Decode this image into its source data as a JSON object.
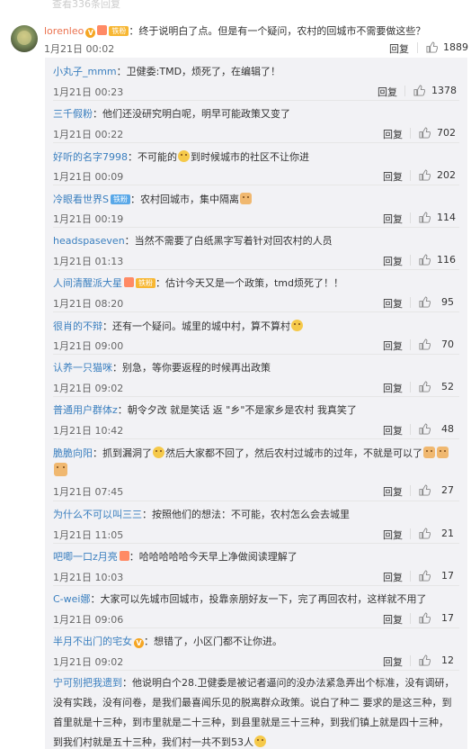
{
  "more_link": "查看336条回复",
  "main": {
    "username": "lorenleo",
    "text": "：终于说明白了点。但是有一个疑问，农村的回城市不需要做这些？",
    "time": "1月21日 00:02",
    "reply_label": "回复",
    "likes": "1889"
  },
  "replies": [
    {
      "user": "小丸子_mmm",
      "text": "：卫健委:TMD，烦死了，在编辑了！",
      "time": "1月21日 00:23",
      "likes": "1378"
    },
    {
      "user": "三千假粉",
      "text": "：他们还没研究明白呢，明早可能政策又变了",
      "time": "1月21日 00:22",
      "likes": "702"
    },
    {
      "user": "好听的名字7998",
      "text_a": "：不可能的",
      "text_b": "到时候城市的社区不让你进",
      "time": "1月21日 00:09",
      "likes": "202"
    },
    {
      "user": "冷眼看世界S",
      "badge": "铁粉",
      "text_a": "：农村回城市，集中隔离",
      "time": "1月21日 00:19",
      "likes": "114"
    },
    {
      "user": "headspaseven",
      "text": "：当然不需要了白纸黑字写着针对回农村的人员",
      "time": "1月21日 01:13",
      "likes": "116"
    },
    {
      "user": "人间清醒派大星",
      "badge": "铁粉",
      "text": "：估计今天又是一个政策，tmd烦死了！！",
      "time": "1月21日 08:20",
      "likes": "95"
    },
    {
      "user": "很肖的不辩",
      "text_a": "：还有一个疑问。城里的城中村，算不算村",
      "time": "1月21日 09:00",
      "likes": "70"
    },
    {
      "user": "认养一只猫咪",
      "text": "：别急，等你要返程的时候再出政策",
      "time": "1月21日 09:02",
      "likes": "52"
    },
    {
      "user": "普通用户群体z",
      "text": "：朝令夕改 就是笑话 返 \"乡\"不是家乡是农村 我真笑了",
      "time": "1月21日 10:42",
      "likes": "48"
    },
    {
      "user": "脆脆向阳",
      "text_a": "：抓到漏洞了",
      "text_b": "然后大家都不回了，然后农村过城市的过年，不就是可以了",
      "time": "1月21日 07:45",
      "likes": "27"
    },
    {
      "user": "为什么不可以叫三三",
      "text": "：按照他们的想法：不可能，农村怎么会去城里",
      "time": "1月21日 11:05",
      "likes": "21"
    },
    {
      "user": "吧唧一口z月亮",
      "text": "：哈哈哈哈哈今天早上净做阅读理解了",
      "time": "1月21日 10:03",
      "likes": "17"
    },
    {
      "user": "C-wei娜",
      "text": "：大家可以先城市回城市，投靠亲朋好友一下，完了再回农村，这样就不用了",
      "time": "1月21日 09:06",
      "likes": "17"
    },
    {
      "user": "半月不出门的宅女",
      "text": "：想错了，小区门都不让你进。",
      "time": "1月21日 09:02",
      "likes": "12"
    },
    {
      "user": "宁可别把我遗到",
      "text_a": "：他说明白个28.卫健委是被记者逼问的没办法紧急弄出个标准，没有调研，没有实践，没有问卷，是我们最喜闻乐见的脱离群众政策。说白了种二 要求的是这三种，到首里就是十三种，到市里就是二十三种，到县里就是三十三种，到我们镇上就是四十三种，到我们村就是五十三种，我们村一共不到53人"
    }
  ],
  "reply_label": "回复",
  "colors": {
    "username_main": "#eb7350",
    "username_sub": "#3a7fbf",
    "sub_bg": "#f2f2f5"
  }
}
